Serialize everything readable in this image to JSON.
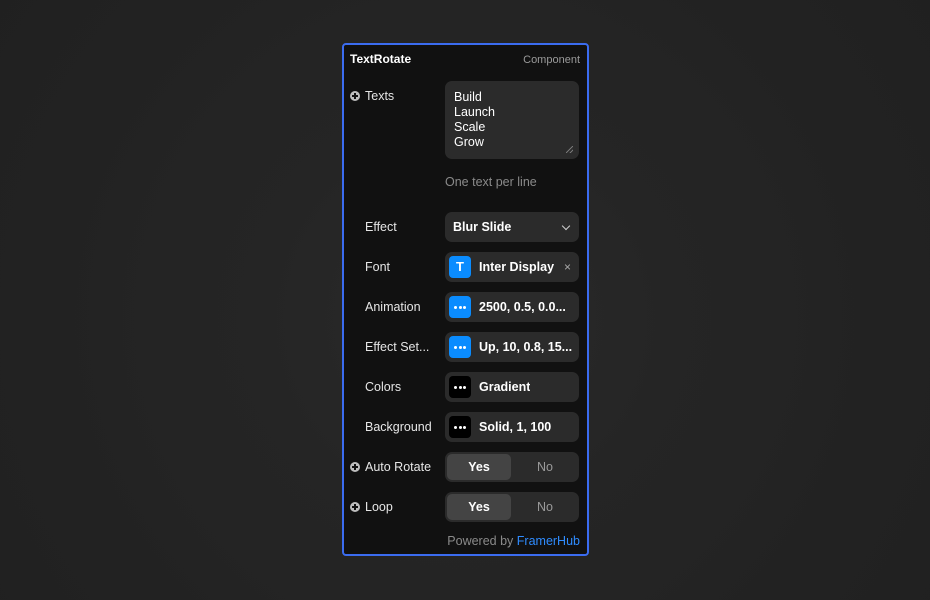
{
  "panel": {
    "title": "TextRotate",
    "kind": "Component"
  },
  "texts": {
    "label": "Texts",
    "lines": [
      "Build",
      "Launch",
      "Scale",
      "Grow"
    ],
    "hint": "One text per line"
  },
  "effect": {
    "label": "Effect",
    "value": "Blur Slide"
  },
  "font": {
    "label": "Font",
    "badge": "T",
    "value": "Inter Display",
    "clear": "×"
  },
  "animation": {
    "label": "Animation",
    "value": "2500, 0.5, 0.0..."
  },
  "effect_settings": {
    "label": "Effect Set...",
    "value": "Up, 10, 0.8, 15..."
  },
  "colors": {
    "label": "Colors",
    "value": "Gradient"
  },
  "background": {
    "label": "Background",
    "value": "Solid, 1, 100"
  },
  "auto_rotate": {
    "label": "Auto Rotate",
    "yes": "Yes",
    "no": "No",
    "selected": "Yes"
  },
  "loop": {
    "label": "Loop",
    "yes": "Yes",
    "no": "No",
    "selected": "Yes"
  },
  "footer": {
    "prefix": "Powered by",
    "link": "FramerHub"
  },
  "colors_theme": {
    "accent": "#3b6cf0",
    "badge_blue": "#0a8cff",
    "link": "#2f8cff",
    "panel_bg": "#111111",
    "control_bg": "#2b2b2b"
  },
  "icons": {
    "plus": "plus-circle-icon",
    "chevron": "chevron-down-icon",
    "more": "more-dots-icon",
    "font": "type-icon",
    "clear": "close-icon",
    "resize": "resize-handle-icon"
  }
}
